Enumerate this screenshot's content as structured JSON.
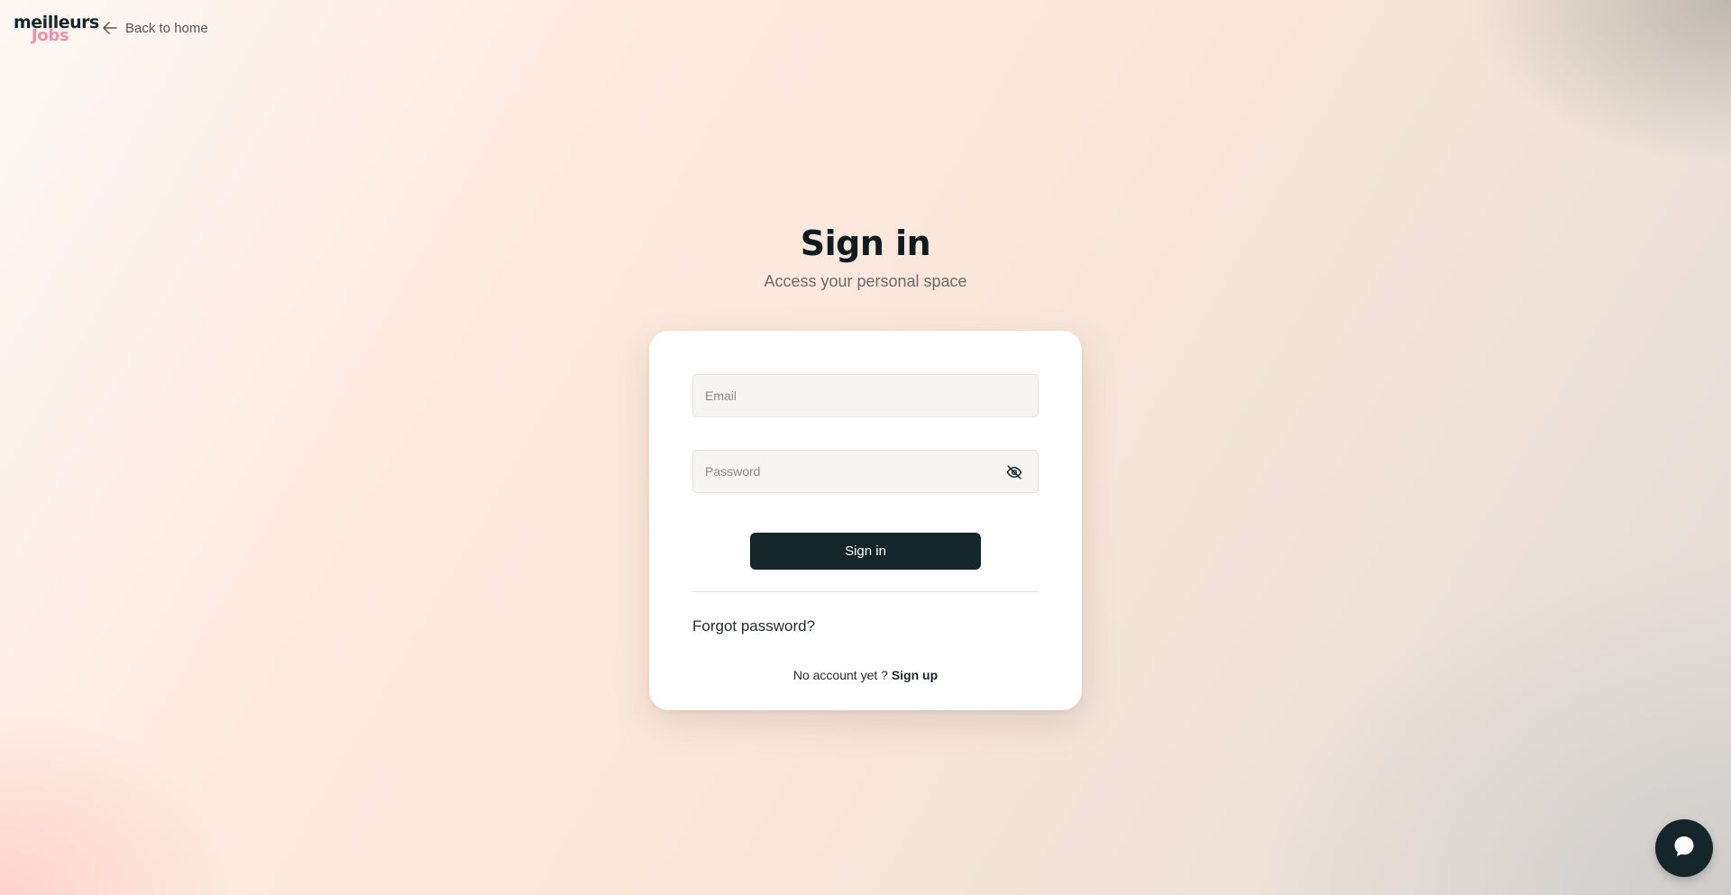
{
  "header": {
    "logo_top": "meilleurs",
    "logo_bottom": "Jobs",
    "back_label": "Back to home"
  },
  "title": "Sign in",
  "subtitle": "Access your personal space",
  "form": {
    "email_placeholder": "Email",
    "email_value": "",
    "password_placeholder": "Password",
    "password_value": "",
    "submit_label": "Sign in",
    "forgot_label": "Forgot password?",
    "no_account_text": "No account yet ?",
    "signup_label": "Sign up"
  },
  "icons": {
    "back": "arrow-left-icon",
    "password_toggle": "eye-off-icon",
    "chat": "chat-bubble-icon"
  },
  "colors": {
    "primary": "#14262a",
    "logo_accent": "#ef8fae",
    "card": "#ffffff"
  }
}
